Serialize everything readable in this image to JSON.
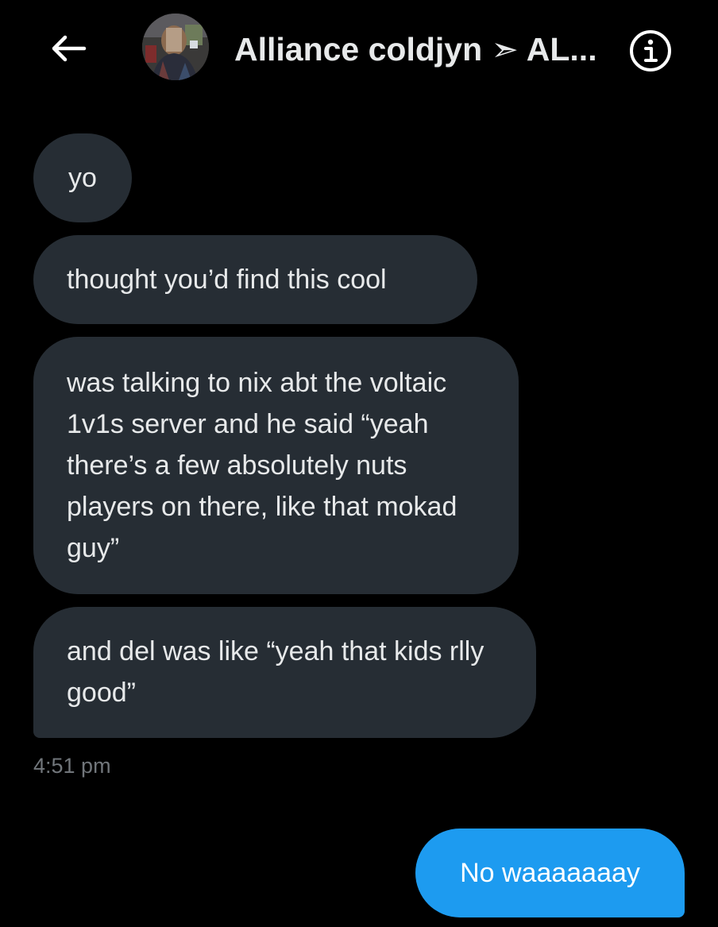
{
  "header": {
    "back_icon": "arrow-left-icon",
    "avatar_icon": "user-avatar",
    "title": "Alliance coldjyn ➣ AL...",
    "info_icon": "info-circle-icon"
  },
  "messages": {
    "received": [
      {
        "text": "yo"
      },
      {
        "text": "thought you’d find this cool"
      },
      {
        "text": "was talking to nix abt the voltaic 1v1s server and he said “yeah there’s a few absolutely nuts players on there, like that mokad guy”"
      },
      {
        "text": "and del was like “yeah that kids rlly good”"
      }
    ],
    "received_time": "4:51 pm",
    "sent": [
      {
        "text": "No waaaaaaay"
      }
    ]
  },
  "colors": {
    "background": "#000000",
    "received_bubble": "#262d34",
    "sent_bubble": "#1d9bf0",
    "text_primary": "#e7e9ea",
    "text_secondary": "#71767b"
  }
}
